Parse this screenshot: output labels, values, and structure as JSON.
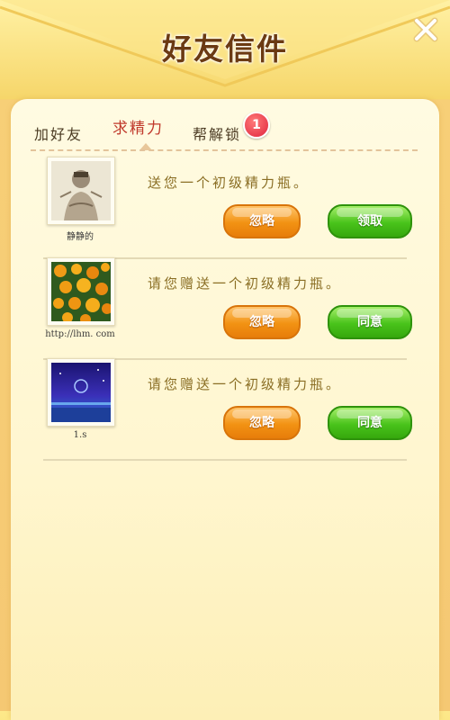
{
  "header": {
    "title": "好友信件"
  },
  "tabs": [
    {
      "label": "加好友",
      "active": false
    },
    {
      "label": "求精力",
      "active": true
    },
    {
      "label": "帮解锁",
      "active": false,
      "badge": "1"
    }
  ],
  "requests": [
    {
      "name": "静静的",
      "message": "送您一个初级精力瓶。",
      "ignore_label": "忽略",
      "action_label": "领取"
    },
    {
      "name": "http://lhm. com",
      "message": "请您赠送一个初级精力瓶。",
      "ignore_label": "忽略",
      "action_label": "同意"
    },
    {
      "name": "1.s",
      "message": "请您赠送一个初级精力瓶。",
      "ignore_label": "忽略",
      "action_label": "同意"
    }
  ],
  "colors": {
    "ignore": "#f29213",
    "accept": "#49c31b",
    "active_tab": "#c0392b"
  }
}
